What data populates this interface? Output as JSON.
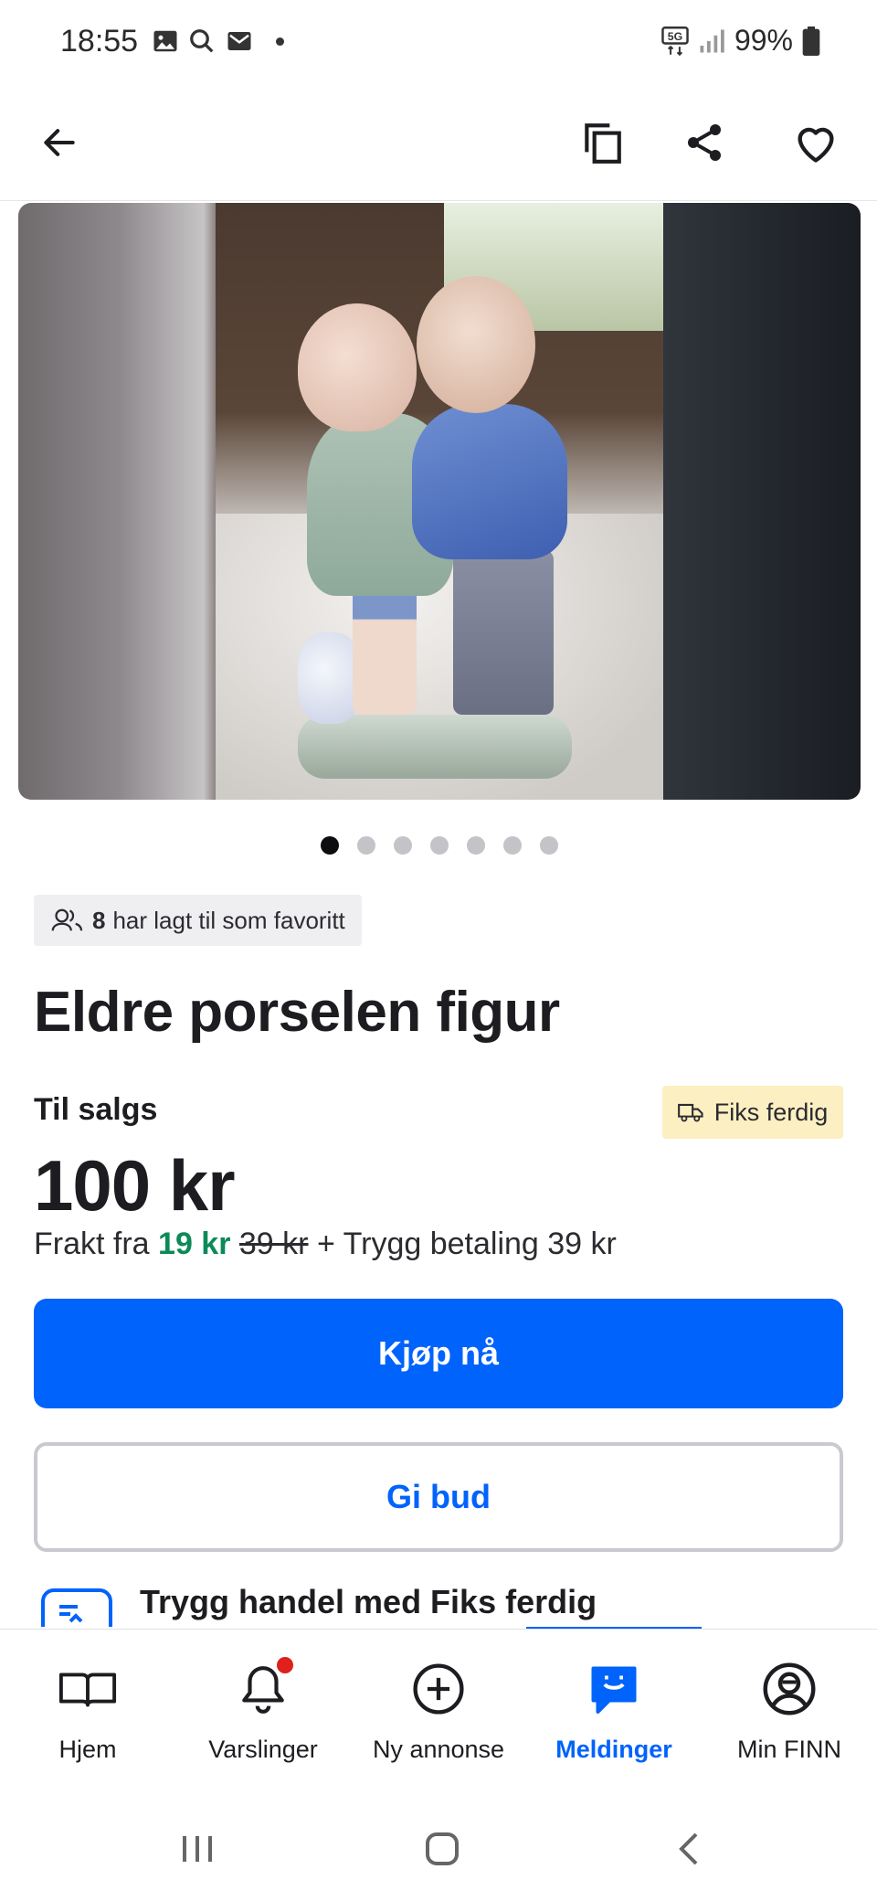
{
  "status_bar": {
    "time": "18:55",
    "battery_text": "99%",
    "network": "5G"
  },
  "top_bar": {
    "icons": [
      "back-arrow-icon",
      "copy-icon",
      "share-icon",
      "heart-icon"
    ]
  },
  "gallery": {
    "image_count": 7,
    "active_index": 0
  },
  "listing": {
    "favorite_count": "8",
    "favorite_text": "har lagt til som favoritt",
    "title": "Eldre porselen figur",
    "status": "Til salgs",
    "badge": "Fiks ferdig",
    "price": "100 kr",
    "shipping_prefix": "Frakt fra",
    "shipping_price": "19 kr",
    "shipping_old_price": "39 kr",
    "shipping_suffix": "+ Trygg betaling 39 kr"
  },
  "actions": {
    "buy_label": "Kjøp nå",
    "bid_label": "Gi bud"
  },
  "safe_trade": {
    "text": "Trygg handel med Fiks ferdig"
  },
  "bottom_nav": {
    "items": [
      {
        "label": "Hjem",
        "icon": "book-icon"
      },
      {
        "label": "Varslinger",
        "icon": "bell-icon"
      },
      {
        "label": "Ny annonse",
        "icon": "plus-circle-icon"
      },
      {
        "label": "Meldinger",
        "icon": "chat-icon"
      },
      {
        "label": "Min FINN",
        "icon": "profile-icon"
      }
    ],
    "active": "Meldinger"
  },
  "colors": {
    "accent": "#0063fb",
    "badge_bg": "#fcefc1",
    "shipping_green": "#0b8a58",
    "notification_red": "#e0201a"
  }
}
